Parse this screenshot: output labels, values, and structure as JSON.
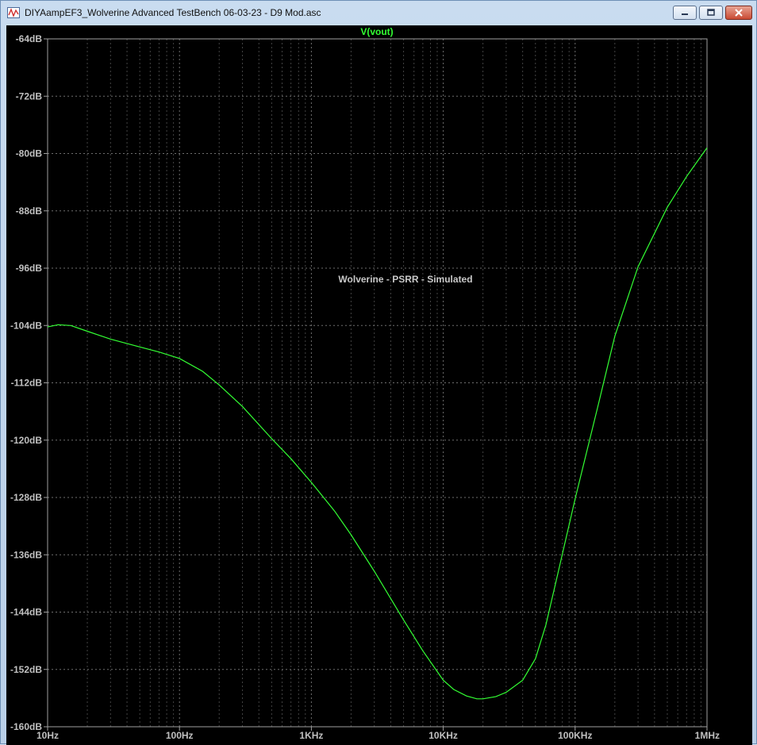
{
  "window": {
    "title": "DIYAampEF3_Wolverine Advanced TestBench 06-03-23 - D9 Mod.asc",
    "app_icon": "waveform-viewer-icon",
    "buttons": {
      "minimize": "minimize-icon",
      "maximize": "maximize-icon",
      "close": "close-icon"
    }
  },
  "colors": {
    "trace": "#33ff33",
    "background": "#000000",
    "grid": "#7a7a7a",
    "axis_text": "#c0c0c0",
    "annotation_text": "#c8c8c8"
  },
  "chart_data": {
    "type": "line",
    "title": "V(vout)",
    "annotation": "Wolverine - PSRR - Simulated",
    "x_scale": "log",
    "xlim": [
      10,
      1000000
    ],
    "ylim": [
      -160,
      -64
    ],
    "x_ticks": [
      {
        "value": 10,
        "label": "10Hz"
      },
      {
        "value": 100,
        "label": "100Hz"
      },
      {
        "value": 1000,
        "label": "1KHz"
      },
      {
        "value": 10000,
        "label": "10KHz"
      },
      {
        "value": 100000,
        "label": "100KHz"
      },
      {
        "value": 1000000,
        "label": "1MHz"
      }
    ],
    "y_ticks": [
      {
        "value": -64,
        "label": "-64dB"
      },
      {
        "value": -72,
        "label": "-72dB"
      },
      {
        "value": -80,
        "label": "-80dB"
      },
      {
        "value": -88,
        "label": "-88dB"
      },
      {
        "value": -96,
        "label": "-96dB"
      },
      {
        "value": -104,
        "label": "-104dB"
      },
      {
        "value": -112,
        "label": "-112dB"
      },
      {
        "value": -120,
        "label": "-120dB"
      },
      {
        "value": -128,
        "label": "-128dB"
      },
      {
        "value": -136,
        "label": "-136dB"
      },
      {
        "value": -144,
        "label": "-144dB"
      },
      {
        "value": -152,
        "label": "-152dB"
      },
      {
        "value": -160,
        "label": "-160dB"
      }
    ],
    "grid": true,
    "series": [
      {
        "name": "V(vout)",
        "x": [
          10,
          12,
          15,
          20,
          30,
          50,
          70,
          100,
          150,
          200,
          300,
          500,
          700,
          1000,
          1500,
          2000,
          3000,
          5000,
          7000,
          10000,
          12000,
          15000,
          18000,
          20000,
          25000,
          30000,
          40000,
          50000,
          60000,
          70000,
          100000,
          150000,
          200000,
          300000,
          500000,
          700000,
          1000000
        ],
        "y": [
          -104.2,
          -103.9,
          -104.0,
          -104.8,
          -105.9,
          -107.0,
          -107.7,
          -108.6,
          -110.4,
          -112.3,
          -115.3,
          -119.8,
          -122.6,
          -125.9,
          -129.9,
          -133.2,
          -138.3,
          -145.1,
          -149.4,
          -153.5,
          -154.8,
          -155.7,
          -156.1,
          -156.1,
          -155.8,
          -155.2,
          -153.5,
          -150.5,
          -145.8,
          -140.5,
          -128.2,
          -115.0,
          -105.5,
          -95.8,
          -87.5,
          -83.2,
          -79.2
        ]
      }
    ]
  }
}
